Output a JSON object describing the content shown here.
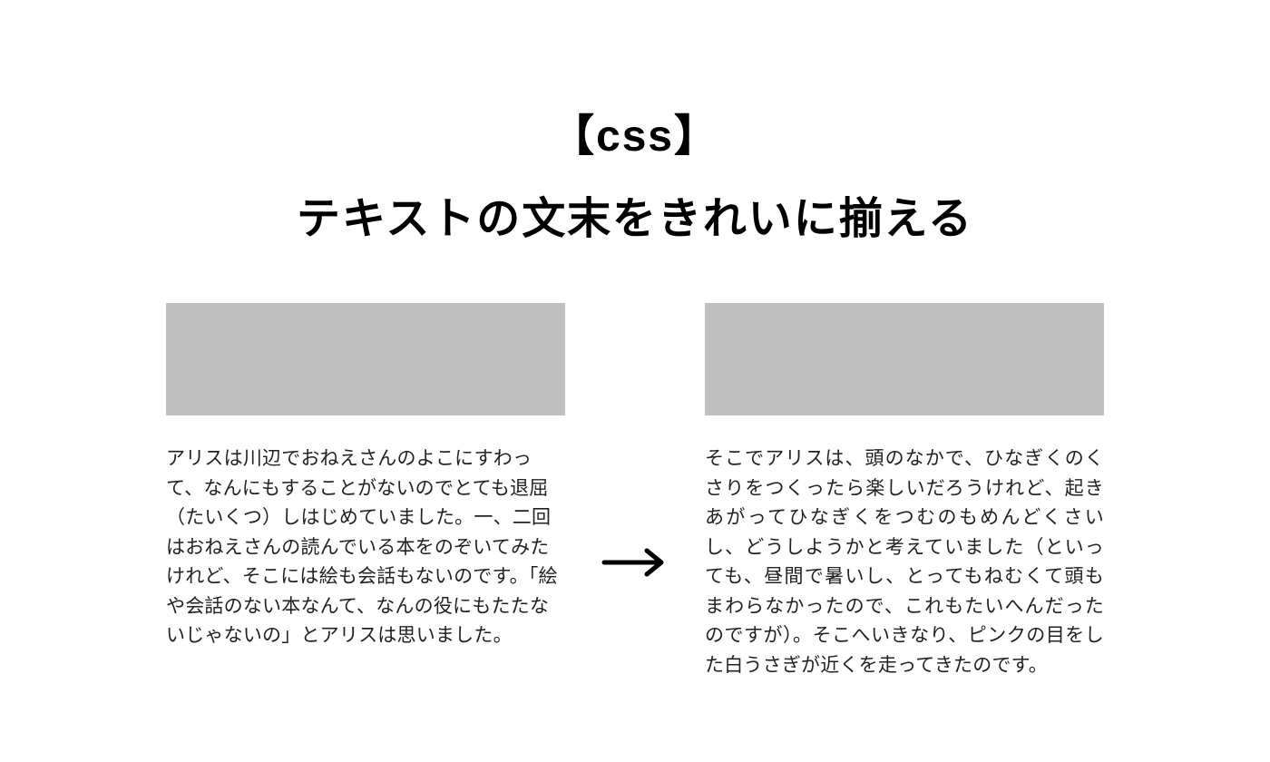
{
  "title": {
    "line1": "【css】",
    "line2": "テキストの文末をきれいに揃える"
  },
  "panels": {
    "left": {
      "text": "アリスは川辺でおねえさんのよこにすわって、なんにもすることがないのでとても退屈（たいくつ）しはじめていました。一、二回はおねえさんの読んでいる本をのぞいてみたけれど、そこには絵も会話もないのです。「絵や会話のない本なんて、なんの役にもたたないじゃないの」とアリスは思いました。"
    },
    "right": {
      "text": "そこでアリスは、頭のなかで、ひなぎくのくさりをつくったら楽しいだろうけれど、起きあがってひなぎくをつむのもめんどくさいし、どうしようかと考えていました（といっても、昼間で暑いし、とってもねむくて頭もまわらなかったので、これもたいへんだったのですが）。そこへいきなり、ピンクの目をした白うさぎが近くを走ってきたのです。"
    }
  }
}
